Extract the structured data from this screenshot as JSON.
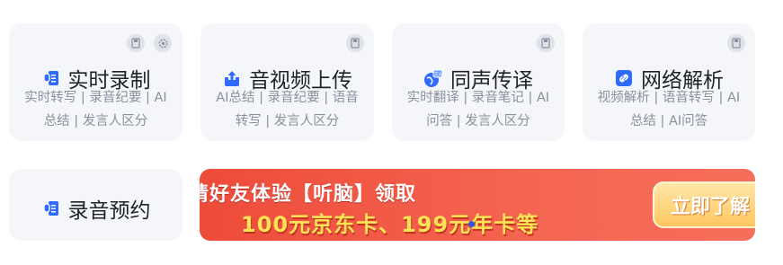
{
  "cards": [
    {
      "title": "实时录制",
      "desc": "实时转写 | 录音纪要 | AI总结 | 发言人区分",
      "icon": "mic-doc-icon"
    },
    {
      "title": "音视频上传",
      "desc": "AI总结 | 录音纪要 | 语音转写 | 发言人区分",
      "icon": "upload-icon"
    },
    {
      "title": "同声传译",
      "desc": "实时翻译 | 录音笔记 | AI问答 | 发言人区分",
      "icon": "translate-globe-icon"
    },
    {
      "title": "网络解析",
      "desc": "视频解析 | 语音转写 | AI总结 | AI问答",
      "icon": "link-icon"
    },
    {
      "title": "录音预约",
      "icon": "mic-doc-icon"
    }
  ],
  "banner": {
    "line1": "请好友体验【听脑】领取",
    "line2": "100元京东卡、199元年卡等",
    "button": "立即了解"
  },
  "colors": {
    "accent": "#2f6bff",
    "card_bg": "#f5f6f9",
    "banner_red": "#ee4b3a",
    "banner_yellow": "#ffe357"
  }
}
